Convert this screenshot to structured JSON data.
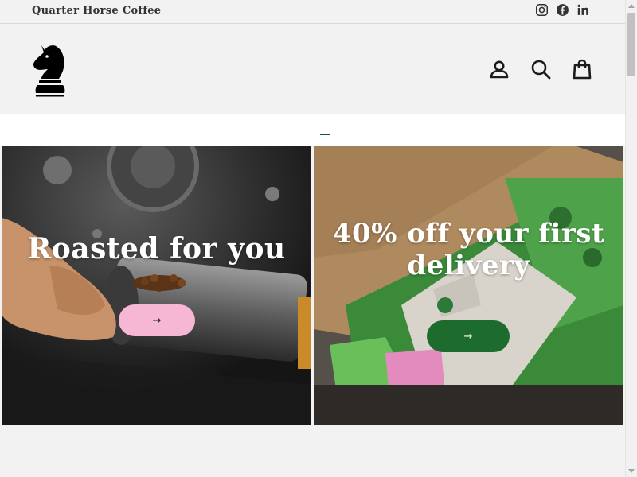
{
  "topbar": {
    "shop_name": "Quarter Horse Coffee",
    "social": [
      {
        "icon": "instagram-icon",
        "label": "Instagram"
      },
      {
        "icon": "facebook-icon",
        "label": "Facebook"
      },
      {
        "icon": "linkedin-icon",
        "label": "LinkedIn"
      }
    ]
  },
  "header": {
    "logo_icon": "knight-chess-piece-logo",
    "icons": [
      "account-icon",
      "search-icon",
      "cart-icon"
    ]
  },
  "announcement": {
    "link_text": ""
  },
  "promos": [
    {
      "title": "Roasted for you",
      "button_label": "→",
      "button_color": "#f5b7d4"
    },
    {
      "title": "40% off your first delivery",
      "button_label": "→",
      "button_color": "#1e6b2e"
    }
  ],
  "colors": {
    "page_background": "#f2f2f2",
    "accent_green": "#1e6b2e",
    "accent_pink": "#f5b7d4"
  }
}
